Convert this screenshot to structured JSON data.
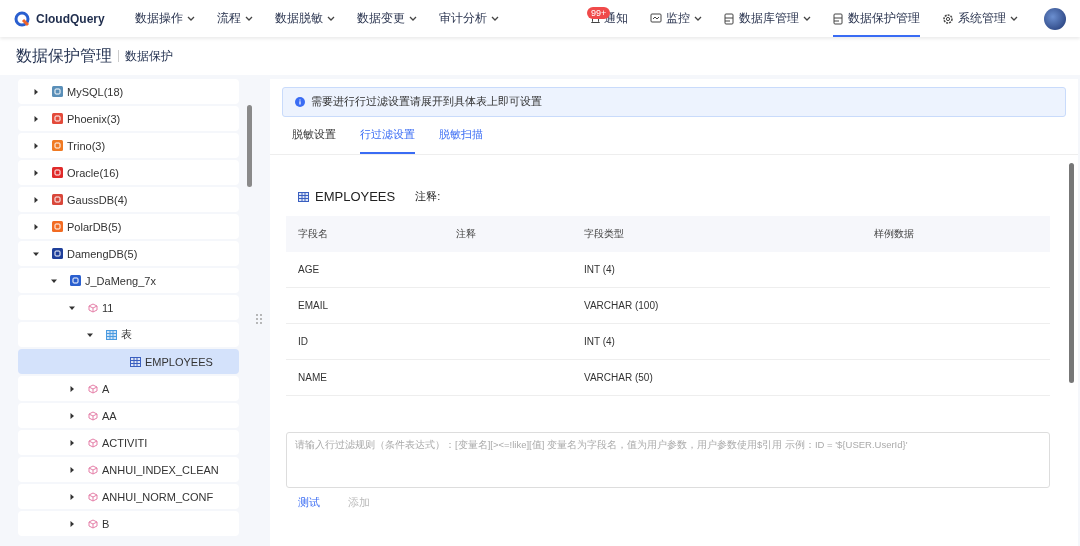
{
  "brand": "CloudQuery",
  "nav": [
    {
      "label": "数据操作",
      "dropdown": true
    },
    {
      "label": "流程",
      "dropdown": true
    },
    {
      "label": "数据脱敏",
      "dropdown": true
    },
    {
      "label": "数据变更",
      "dropdown": true
    },
    {
      "label": "审计分析",
      "dropdown": true
    }
  ],
  "right_nav": [
    {
      "kind": "bell",
      "label": "通知",
      "badge": "99+",
      "dropdown": false,
      "selected": false
    },
    {
      "kind": "monitor",
      "label": "监控",
      "dropdown": true,
      "selected": false
    },
    {
      "kind": "database",
      "label": "数据库管理",
      "dropdown": true,
      "selected": false
    },
    {
      "kind": "database",
      "label": "数据保护管理",
      "dropdown": false,
      "selected": true
    },
    {
      "kind": "gear",
      "label": "系统管理",
      "dropdown": true,
      "selected": false
    }
  ],
  "breadcrumb": {
    "title": "数据保护管理",
    "sub": "数据保护"
  },
  "tree": [
    {
      "label": "MySQL(18)",
      "kind": "mysql",
      "expanded": false,
      "selected": false
    },
    {
      "label": "Phoenix(3)",
      "kind": "phoenix",
      "expanded": false,
      "selected": false
    },
    {
      "label": "Trino(3)",
      "kind": "trino",
      "expanded": false,
      "selected": false
    },
    {
      "label": "Oracle(16)",
      "kind": "oracle",
      "expanded": false,
      "selected": false
    },
    {
      "label": "GaussDB(4)",
      "kind": "gauss",
      "expanded": false,
      "selected": false
    },
    {
      "label": "PolarDB(5)",
      "kind": "polar",
      "expanded": false,
      "selected": false
    },
    {
      "label": "DamengDB(5)",
      "kind": "dameng",
      "expanded": true,
      "selected": false,
      "children": [
        {
          "label": "J_DaMeng_7x",
          "kind": "connection",
          "expanded": true,
          "selected": false,
          "children": [
            {
              "label": "11",
              "kind": "schema",
              "expanded": true,
              "selected": false,
              "children": [
                {
                  "label": "表",
                  "kind": "folder",
                  "expanded": true,
                  "selected": false,
                  "children": [
                    {
                      "label": "EMPLOYEES",
                      "kind": "table",
                      "selected": true
                    }
                  ]
                }
              ]
            },
            {
              "label": "A",
              "kind": "schema",
              "expanded": false,
              "selected": false
            },
            {
              "label": "AA",
              "kind": "schema",
              "expanded": false,
              "selected": false
            },
            {
              "label": "ACTIVITI",
              "kind": "schema",
              "expanded": false,
              "selected": false
            },
            {
              "label": "ANHUI_INDEX_CLEAN",
              "kind": "schema",
              "expanded": false,
              "selected": false
            },
            {
              "label": "ANHUI_NORM_CONF",
              "kind": "schema",
              "expanded": false,
              "selected": false
            },
            {
              "label": "B",
              "kind": "schema",
              "expanded": false,
              "selected": false
            }
          ]
        }
      ]
    }
  ],
  "alert": "需要进行行过滤设置请展开到具体表上即可设置",
  "tabs": [
    {
      "label": "脱敏设置",
      "selected": false,
      "hovered": false
    },
    {
      "label": "行过滤设置",
      "selected": true,
      "hovered": false
    },
    {
      "label": "脱敏扫描",
      "selected": false,
      "hovered": true
    }
  ],
  "table_title": "EMPLOYEES",
  "comment_label": "注释:",
  "table": {
    "columns": [
      "字段名",
      "注释",
      "字段类型",
      "样例数据"
    ],
    "rows": [
      [
        "AGE",
        "",
        "INT (4)",
        ""
      ],
      [
        "EMAIL",
        "",
        "VARCHAR (100)",
        ""
      ],
      [
        "ID",
        "",
        "INT (4)",
        ""
      ],
      [
        "NAME",
        "",
        "VARCHAR (50)",
        ""
      ]
    ]
  },
  "filter": {
    "placeholder": "请输入行过滤规则（条件表达式）：[变量名][><=!like][值] 变量名为字段名，值为用户参数，用户参数使用$引用 示例：ID = '${USER.UserId}'"
  },
  "actions": [
    {
      "label": "测试",
      "disabled": false
    },
    {
      "label": "添加",
      "disabled": true
    }
  ]
}
